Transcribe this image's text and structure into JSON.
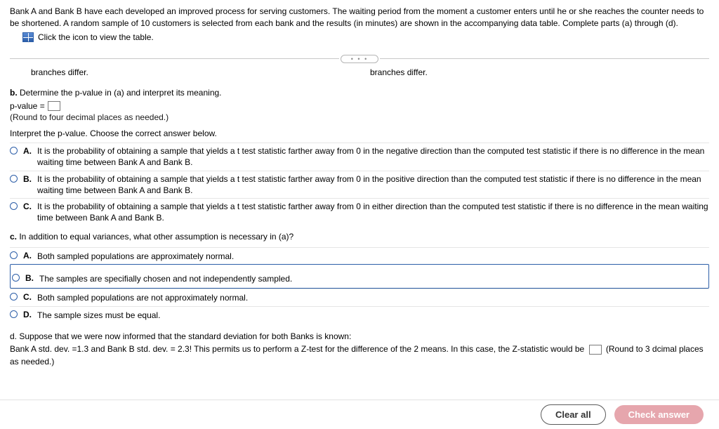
{
  "intro": "Bank A and Bank B have each developed an improved process for serving customers. The waiting period from the moment a customer enters until he or she reaches the counter needs to be shortened. A random sample of 10 customers is selected from each bank and the results (in minutes) are shown in the accompanying data table. Complete parts (a) through (d).",
  "table_link_label": "Click the icon to view the table.",
  "show_more_glyph": "• • •",
  "branches_left": "branches differ.",
  "branches_right": "branches differ.",
  "part_b_heading": "b. Determine the p-value in (a) and interpret its meaning.",
  "pvalue_label": "p-value =",
  "pvalue_hint": "(Round to four decimal places as needed.)",
  "interpret_prompt": "Interpret the p-value. Choose the correct answer below.",
  "interpret_options": [
    {
      "label": "A.",
      "text": "It is the probability of obtaining a sample that yields a t test statistic farther away from 0 in the negative direction than the computed test statistic if there is no difference in the mean waiting time between Bank A and Bank B."
    },
    {
      "label": "B.",
      "text": "It is the probability of obtaining a sample that yields a t test statistic farther away from 0 in the positive direction than the computed test statistic if there is no difference in the mean waiting time between Bank A and Bank B."
    },
    {
      "label": "C.",
      "text": "It is the probability of obtaining a sample that yields a t test statistic farther away from 0 in either direction than the computed test statistic if there is no difference in the mean waiting time between Bank A and Bank B."
    }
  ],
  "part_c_heading": "c. In addition to equal variances, what other assumption is necessary in (a)?",
  "assumption_options": [
    {
      "label": "A.",
      "text": "Both sampled populations are approximately normal."
    },
    {
      "label": "B.",
      "text": "The samples are specifially chosen and not independently sampled."
    },
    {
      "label": "C.",
      "text": "Both sampled populations are not approximately normal."
    },
    {
      "label": "D.",
      "text": "The sample sizes must be equal."
    }
  ],
  "part_d_line1": "d.  Suppose that we were now informed  that the standard deviation for both Banks is known:",
  "part_d_line2_pre": "Bank A std. dev. =1.3  and Bank B std. dev. = 2.3!   This permits us to perform a Z-test for the difference of the 2 means.  In this case, the Z-statistic would be",
  "part_d_hint": "(Round to 3 dcimal places as needed.)",
  "footer": {
    "clear": "Clear all",
    "check": "Check answer"
  }
}
